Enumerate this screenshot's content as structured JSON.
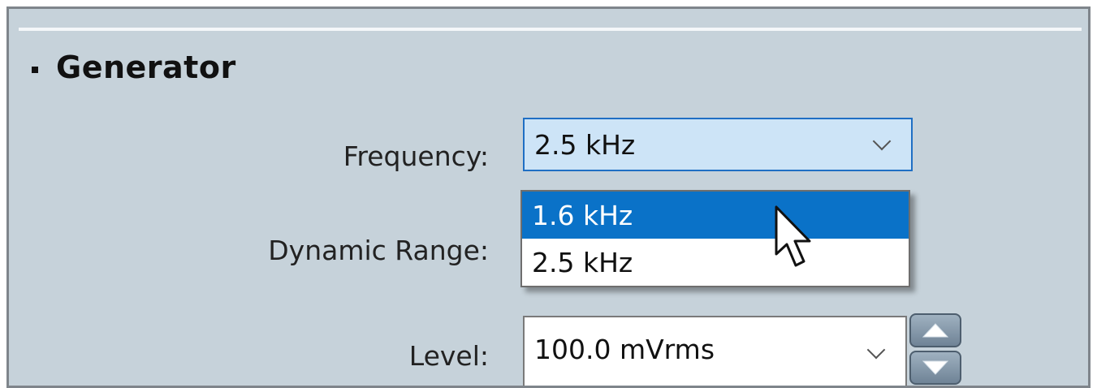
{
  "section": {
    "title": "Generator"
  },
  "fields": {
    "frequency": {
      "label": "Frequency:",
      "value": "2.5 kHz"
    },
    "dynamic_range": {
      "label": "Dynamic Range:"
    },
    "level": {
      "label": "Level:",
      "value": "100.0 mVrms"
    }
  },
  "frequency_dropdown": {
    "options": [
      "1.6 kHz",
      "2.5 kHz"
    ],
    "highlighted_index": 0
  },
  "icons": {
    "combo_arrow": "chevron-down-icon",
    "cursor": "mouse-pointer-icon",
    "spin_up": "triangle-up-icon",
    "spin_down": "triangle-down-icon"
  },
  "colors": {
    "panel_bg": "#c6d2da",
    "focus_bg": "#cde4f7",
    "focus_border": "#1f6fc4",
    "highlight": "#0a72c8"
  }
}
